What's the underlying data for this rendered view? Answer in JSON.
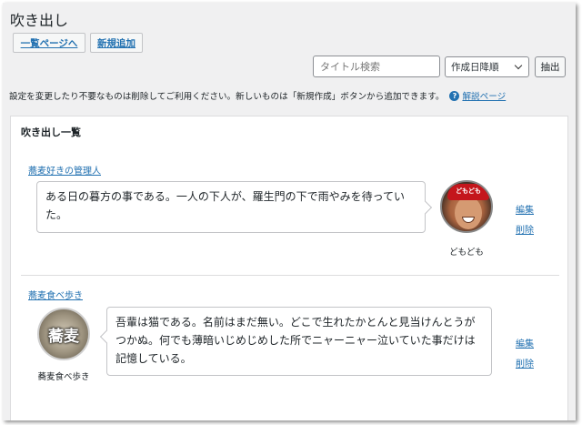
{
  "page": {
    "title": "吹き出し"
  },
  "toolbar": {
    "list_button": "一覧ページへ",
    "new_button": "新規追加",
    "search_placeholder": "タイトル検索",
    "sort_selected": "作成日降順",
    "filter_button": "抽出"
  },
  "notice": {
    "text": "設定を変更したり不要なものは削除してご利用ください。新しいものは「新規作成」ボタンから追加できます。",
    "help_link": "解説ページ"
  },
  "panel": {
    "title": "吹き出し一覧",
    "items": [
      {
        "author": "蕎麦好きの管理人",
        "text": "ある日の暮方の事である。一人の下人が、羅生門の下で雨やみを待っていた。",
        "avatar_name": "どもども",
        "avatar_cap": "どもども",
        "edit": "編集",
        "delete": "削除"
      },
      {
        "author": "蕎麦食べ歩き",
        "text": "吾輩は猫である。名前はまだ無い。どこで生れたかとんと見当けんとうがつかぬ。何でも薄暗いじめじめした所でニャーニャー泣いていた事だけは記憶している。",
        "avatar_name": "蕎麦食べ歩き",
        "avatar_text": "蕎麦",
        "edit": "編集",
        "delete": "削除"
      }
    ]
  }
}
